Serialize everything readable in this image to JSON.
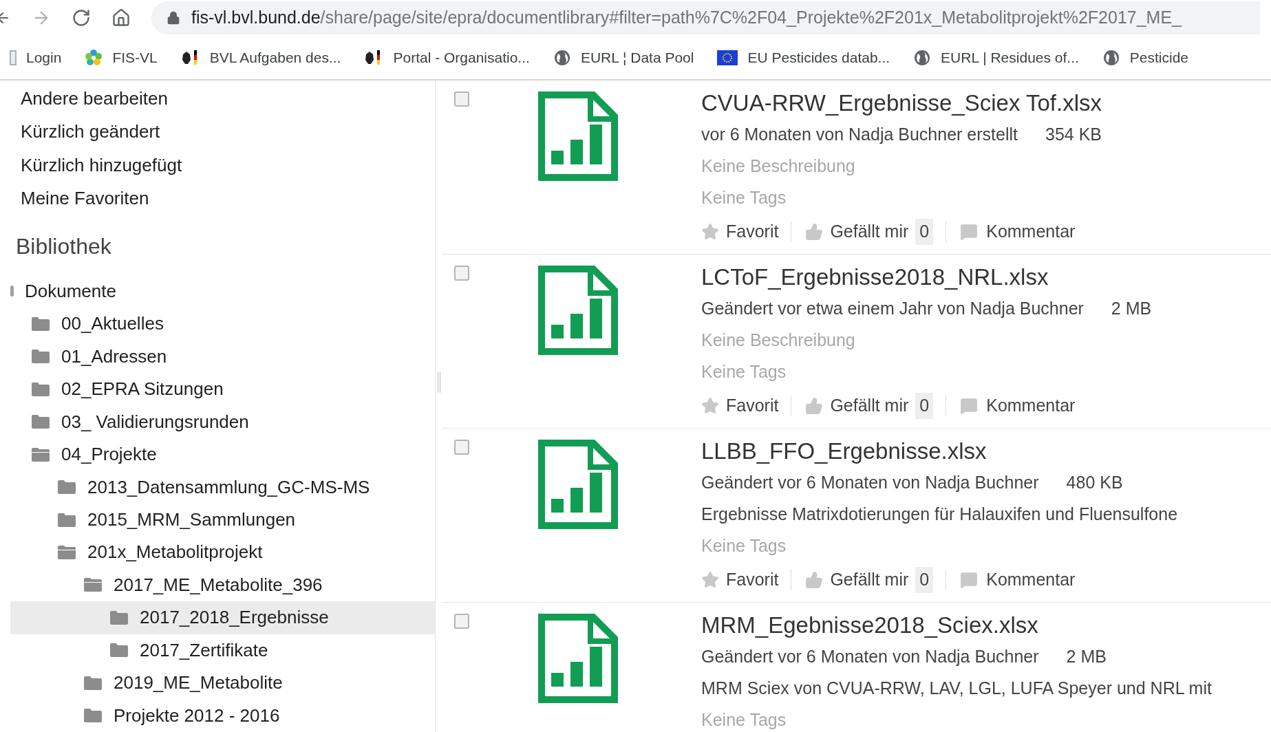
{
  "browser": {
    "url_host": "fis-vl.bvl.bund.de",
    "url_path": "/share/page/site/epra/documentlibrary#filter=path%7C%2F04_Projekte%2F201x_Metabolitprojekt%2F2017_ME_",
    "bookmarks": [
      {
        "label": "Login",
        "kind": "page"
      },
      {
        "label": "FIS-VL",
        "kind": "pinwheel"
      },
      {
        "label": "BVL Aufgaben des...",
        "kind": "eagle"
      },
      {
        "label": "Portal - Organisatio...",
        "kind": "eagle"
      },
      {
        "label": "EURL ¦ Data Pool",
        "kind": "globe"
      },
      {
        "label": "EU Pesticides datab...",
        "kind": "eu"
      },
      {
        "label": "EURL | Residues of...",
        "kind": "globe"
      },
      {
        "label": "Pesticide",
        "kind": "globe"
      }
    ]
  },
  "sidebar": {
    "links": [
      "Andere bearbeiten",
      "Kürzlich geändert",
      "Kürzlich hinzugefügt",
      "Meine Favoriten"
    ],
    "section_title": "Bibliothek",
    "library_root": "Dokumente",
    "tree": [
      {
        "label": "00_Aktuelles",
        "expanded": false,
        "selected": false
      },
      {
        "label": "01_Adressen",
        "expanded": false,
        "selected": false
      },
      {
        "label": "02_EPRA Sitzungen",
        "expanded": false,
        "selected": false
      },
      {
        "label": "03_ Validierungsrunden",
        "expanded": false,
        "selected": false
      },
      {
        "label": "04_Projekte",
        "expanded": true,
        "selected": false,
        "children": [
          {
            "label": "2013_Datensammlung_GC-MS-MS",
            "expanded": false,
            "selected": false
          },
          {
            "label": "2015_MRM_Sammlungen",
            "expanded": false,
            "selected": false
          },
          {
            "label": "201x_Metabolitprojekt",
            "expanded": true,
            "selected": false,
            "children": [
              {
                "label": "2017_ME_Metabolite_396",
                "expanded": true,
                "selected": false,
                "children": [
                  {
                    "label": "2017_2018_Ergebnisse",
                    "expanded": false,
                    "selected": true
                  },
                  {
                    "label": "2017_Zertifikate",
                    "expanded": false,
                    "selected": false
                  }
                ]
              },
              {
                "label": "2019_ME_Metabolite",
                "expanded": false,
                "selected": false
              },
              {
                "label": "Projekte 2012 - 2016",
                "expanded": false,
                "selected": false
              }
            ]
          }
        ]
      }
    ]
  },
  "documents": [
    {
      "name": "CVUA-RRW_Ergebnisse_Sciex Tof.xlsx",
      "checked": false,
      "meta": "vor 6 Monaten von Nadja Buchner erstellt",
      "size": "354 KB",
      "description": {
        "text": "Keine Beschreibung",
        "empty": true
      },
      "tags": "Keine Tags",
      "actions": {
        "favorite": "Favorit",
        "like": "Gefällt mir",
        "like_count": "0",
        "comment": "Kommentar"
      }
    },
    {
      "name": "LCToF_Ergebnisse2018_NRL.xlsx",
      "checked": false,
      "meta": "Geändert vor etwa einem Jahr von Nadja Buchner",
      "size": "2 MB",
      "description": {
        "text": "Keine Beschreibung",
        "empty": true
      },
      "tags": "Keine Tags",
      "actions": {
        "favorite": "Favorit",
        "like": "Gefällt mir",
        "like_count": "0",
        "comment": "Kommentar"
      }
    },
    {
      "name": "LLBB_FFO_Ergebnisse.xlsx",
      "checked": false,
      "meta": "Geändert vor 6 Monaten von Nadja Buchner",
      "size": "480 KB",
      "description": {
        "text": "Ergebnisse Matrixdotierungen für Halauxifen und Fluensulfone",
        "empty": false
      },
      "tags": "Keine Tags",
      "actions": {
        "favorite": "Favorit",
        "like": "Gefällt mir",
        "like_count": "0",
        "comment": "Kommentar"
      }
    },
    {
      "name": "MRM_Egebnisse2018_Sciex.xlsx",
      "checked": false,
      "meta": "Geändert vor 6 Monaten von Nadja Buchner",
      "size": "2 MB",
      "description": {
        "text": "MRM Sciex von CVUA-RRW, LAV, LGL, LUFA Speyer und NRL mit",
        "empty": false
      },
      "tags": "Keine Tags"
    }
  ]
}
